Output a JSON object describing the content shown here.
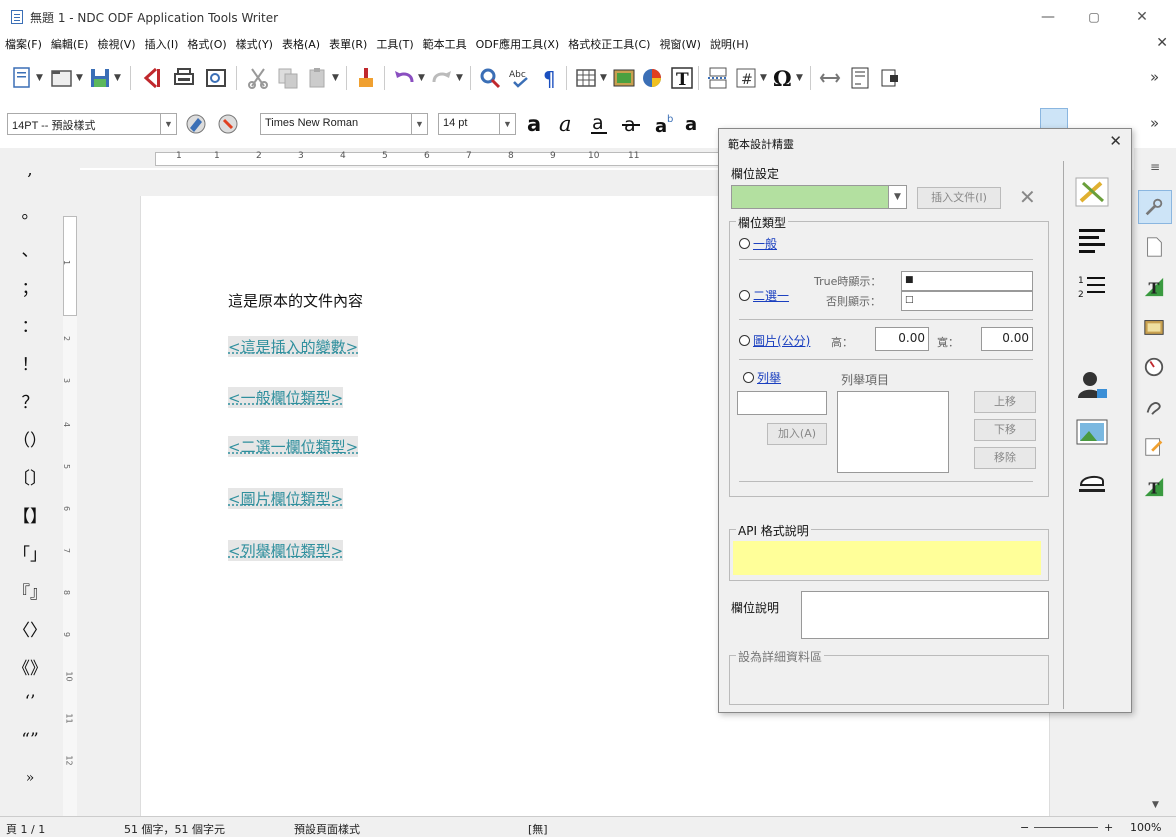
{
  "window": {
    "title": "無題 1 - NDC ODF Application Tools Writer",
    "minimize": "—",
    "maximize": "▢",
    "close": "✕"
  },
  "menu": {
    "items": [
      "檔案(F)",
      "編輯(E)",
      "檢視(V)",
      "插入(I)",
      "格式(O)",
      "樣式(Y)",
      "表格(A)",
      "表單(R)",
      "工具(T)",
      "範本工具",
      "ODF應用工具(X)",
      "格式校正工具(C)",
      "視窗(W)",
      "說明(H)"
    ],
    "close": "✕"
  },
  "format_toolbar": {
    "paragraph_style": "14PT -- 預設樣式",
    "font_name": "Times New Roman",
    "font_size": "14 pt",
    "more": "»"
  },
  "standard_toolbar": {
    "more": "»"
  },
  "symbols": [
    ",",
    "。",
    "、",
    "；",
    "：",
    "！",
    "？",
    "（）",
    "〔〕",
    "【】",
    "「」",
    "『』",
    "〈〉",
    "《》",
    "‘’",
    "“”",
    "»"
  ],
  "hruler_numbers": [
    "1",
    "1",
    "2",
    "3",
    "4",
    "5",
    "6",
    "7",
    "8",
    "9",
    "10",
    "11"
  ],
  "vruler_numbers": [
    "1",
    "2",
    "3",
    "4",
    "5",
    "6",
    "7",
    "8",
    "9",
    "10",
    "11",
    "12"
  ],
  "document": {
    "line1": "這是原本的文件內容",
    "fields": [
      "<這是插入的變數>",
      "<一般欄位類型>",
      "<二選一欄位類型>",
      "<圖片欄位類型>",
      "<列舉欄位類型>"
    ]
  },
  "dialog": {
    "title": "範本設計精靈",
    "close": "✕",
    "field_settings_label": "欄位設定",
    "field_name_value": "",
    "insert_button": "插入文件(I)",
    "clear_icon": "✕",
    "field_type_group": "欄位類型",
    "type_general": "一般",
    "type_binary": "二選一",
    "true_label": "True時顯示：",
    "true_value": "■",
    "else_label": "否則顯示：",
    "else_value": "□",
    "type_image": "圖片(公分)",
    "height_label": "高：",
    "height_value": "0.00",
    "width_label": "寬：",
    "width_value": "0.00",
    "type_enum": "列舉",
    "enum_items_label": "列舉項目",
    "add_button": "加入(A)",
    "move_up_button": "上移",
    "move_down_button": "下移",
    "remove_button": "移除",
    "api_group": "API 格式說明",
    "field_desc_label": "欄位說明",
    "detail_group": "設為詳細資料區",
    "api_color": "#ffff99",
    "field_color": "#b3e0a0"
  },
  "status": {
    "page": "頁 1 / 1",
    "words": "51 個字，51 個字元",
    "page_style": "預設頁面樣式",
    "language": "[無]",
    "zoom": "100%",
    "zoom_minus": "−",
    "zoom_plus": "+"
  }
}
